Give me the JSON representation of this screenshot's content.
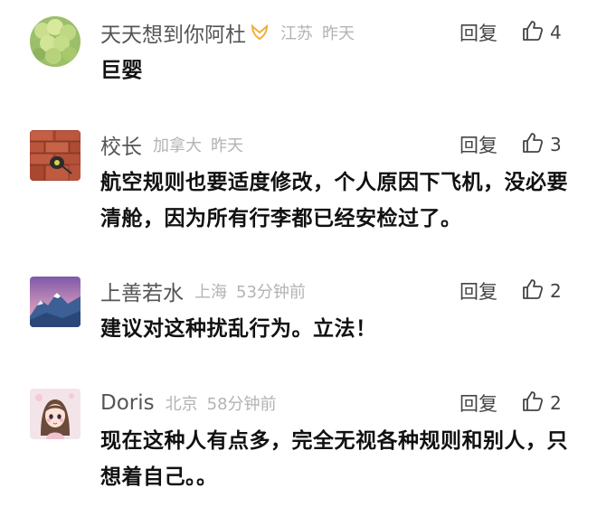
{
  "comments": [
    {
      "username": "天天想到你阿杜",
      "has_badge": true,
      "location": "江苏",
      "time": "昨天",
      "reply_label": "回复",
      "likes": "4",
      "text": "巨婴"
    },
    {
      "username": "校长",
      "has_badge": false,
      "location": "加拿大",
      "time": "昨天",
      "reply_label": "回复",
      "likes": "3",
      "text": "航空规则也要适度修改，个人原因下飞机，没必要清舱，因为所有行李都已经安检过了。"
    },
    {
      "username": "上善若水",
      "has_badge": false,
      "location": "上海",
      "time": "53分钟前",
      "reply_label": "回复",
      "likes": "2",
      "text": "建议对这种扰乱行为。立法！"
    },
    {
      "username": "Doris",
      "has_badge": false,
      "location": "北京",
      "time": "58分钟前",
      "reply_label": "回复",
      "likes": "2",
      "text": "现在这种人有点多，完全无视各种规则和别人，只想着自己。。"
    }
  ],
  "icons": {
    "badge": "vip-badge-icon",
    "like": "thumbs-up-icon"
  },
  "colors": {
    "badge": "#f0b040",
    "meta": "#b3b3b3",
    "username": "#555555"
  }
}
